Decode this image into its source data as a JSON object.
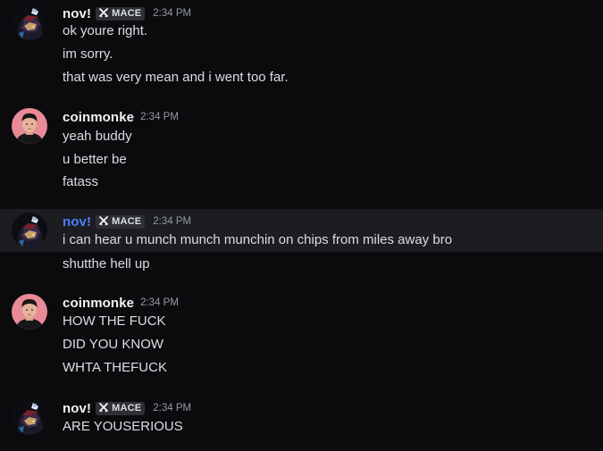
{
  "messages": [
    {
      "author": "nov!",
      "tag": "MACE",
      "time": "2:34 PM",
      "lines": [
        "ok youre right.",
        "im sorry.",
        "that was very mean and i went too far."
      ]
    },
    {
      "author": "coinmonke",
      "time": "2:34 PM",
      "lines": [
        "yeah buddy",
        "u better be",
        "fatass"
      ]
    },
    {
      "author": "nov!",
      "tag": "MACE",
      "time": "2:34 PM",
      "lines": [
        "i can hear u munch munch munchin on chips from miles away bro",
        "shutthe hell up"
      ]
    },
    {
      "author": "coinmonke",
      "time": "2:34 PM",
      "lines": [
        "HOW THE FUCK",
        "DID YOU KNOW",
        "WHTA THEFUCK"
      ]
    },
    {
      "author": "nov!",
      "tag": "MACE",
      "time": "2:34 PM",
      "lines": [
        "ARE YOUSERIOUS"
      ]
    }
  ],
  "colors": {
    "background": "#0b0b0e",
    "hover_background": "#1c1d21",
    "username": "#f2f3f5",
    "username_highlight": "#4e7dff",
    "timestamp": "#949ba4",
    "tag_background": "#2e3035",
    "text": "#dbdee1"
  },
  "icons": {
    "tag": "crossed-swords-icon",
    "nov_avatar": "anime-character-avatar",
    "coinmonke_avatar": "person-photo-avatar"
  }
}
